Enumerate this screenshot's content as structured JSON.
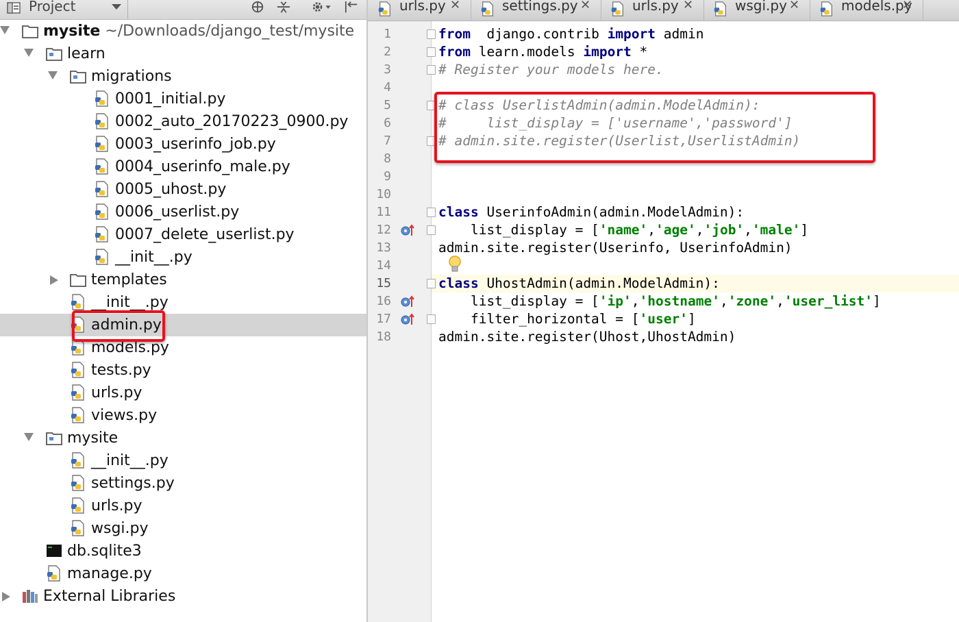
{
  "project_panel": {
    "title": "Project",
    "tree": [
      {
        "label": "mysite",
        "path": "~/Downloads/django_test/mysite",
        "kind": "folder",
        "bold": true,
        "expanded": true,
        "depth": 0
      },
      {
        "label": "learn",
        "kind": "module",
        "expanded": true,
        "depth": 1
      },
      {
        "label": "migrations",
        "kind": "module",
        "expanded": true,
        "depth": 2
      },
      {
        "label": "0001_initial.py",
        "kind": "py",
        "depth": 3
      },
      {
        "label": "0002_auto_20170223_0900.py",
        "kind": "py",
        "depth": 3
      },
      {
        "label": "0003_userinfo_job.py",
        "kind": "py",
        "depth": 3
      },
      {
        "label": "0004_userinfo_male.py",
        "kind": "py",
        "depth": 3
      },
      {
        "label": "0005_uhost.py",
        "kind": "py",
        "depth": 3
      },
      {
        "label": "0006_userlist.py",
        "kind": "py",
        "depth": 3
      },
      {
        "label": "0007_delete_userlist.py",
        "kind": "py",
        "depth": 3
      },
      {
        "label": "__init__.py",
        "kind": "py",
        "depth": 3
      },
      {
        "label": "templates",
        "kind": "folder",
        "expanded": false,
        "depth": 2
      },
      {
        "label": "__init__.py",
        "kind": "py",
        "depth": 2
      },
      {
        "label": "admin.py",
        "kind": "py",
        "depth": 2,
        "selected": true
      },
      {
        "label": "models.py",
        "kind": "py",
        "depth": 2
      },
      {
        "label": "tests.py",
        "kind": "py",
        "depth": 2
      },
      {
        "label": "urls.py",
        "kind": "py",
        "depth": 2
      },
      {
        "label": "views.py",
        "kind": "py",
        "depth": 2
      },
      {
        "label": "mysite",
        "kind": "module",
        "expanded": true,
        "depth": 1
      },
      {
        "label": "__init__.py",
        "kind": "py",
        "depth": 2
      },
      {
        "label": "settings.py",
        "kind": "py",
        "depth": 2
      },
      {
        "label": "urls.py",
        "kind": "py",
        "depth": 2
      },
      {
        "label": "wsgi.py",
        "kind": "py",
        "depth": 2
      },
      {
        "label": "db.sqlite3",
        "kind": "db",
        "depth": 1
      },
      {
        "label": "manage.py",
        "kind": "py",
        "depth": 1
      },
      {
        "label": "External Libraries",
        "kind": "lib",
        "expanded": false,
        "depth": 0
      }
    ]
  },
  "editor": {
    "tabs": [
      {
        "label": "urls.py",
        "close": "✕"
      },
      {
        "label": "settings.py",
        "close": "✕"
      },
      {
        "label": "urls.py",
        "close": "✕"
      },
      {
        "label": "wsgi.py",
        "close": "✕"
      },
      {
        "label": "models.py",
        "close": "✕"
      }
    ],
    "current_line": 15,
    "lines": [
      [
        [
          "kw",
          "from"
        ],
        [
          "",
          "  django.contrib "
        ],
        [
          "kw",
          "import"
        ],
        [
          "",
          " admin"
        ]
      ],
      [
        [
          "kw",
          "from"
        ],
        [
          "",
          " learn.models "
        ],
        [
          "kw",
          "import"
        ],
        [
          "",
          " *"
        ]
      ],
      [
        [
          "cmt",
          "# Register your models here."
        ]
      ],
      [],
      [
        [
          "cmt",
          "# class UserlistAdmin(admin.ModelAdmin):"
        ]
      ],
      [
        [
          "cmt",
          "#     list_display = ['username','password']"
        ]
      ],
      [
        [
          "cmt",
          "# admin.site.register(Userlist,UserlistAdmin)"
        ]
      ],
      [],
      [],
      [],
      [
        [
          "kw",
          "class"
        ],
        [
          "",
          " UserinfoAdmin(admin.ModelAdmin):"
        ]
      ],
      [
        [
          "",
          "    list_display = ["
        ],
        [
          "str",
          "'name'"
        ],
        [
          "",
          ","
        ],
        [
          "str",
          "'age'"
        ],
        [
          "",
          ","
        ],
        [
          "str",
          "'job'"
        ],
        [
          "",
          ","
        ],
        [
          "str",
          "'male'"
        ],
        [
          "",
          "]"
        ]
      ],
      [
        [
          "",
          "admin.site.register(Userinfo, UserinfoAdmin)"
        ]
      ],
      [],
      [
        [
          "kw",
          "class"
        ],
        [
          "",
          " UhostAdmin(admin.ModelAdmin):"
        ]
      ],
      [
        [
          "",
          "    list_display = ["
        ],
        [
          "str",
          "'ip'"
        ],
        [
          "",
          ","
        ],
        [
          "str",
          "'hostname'"
        ],
        [
          "",
          ","
        ],
        [
          "str",
          "'zone'"
        ],
        [
          "",
          ","
        ],
        [
          "str",
          "'user_list'"
        ],
        [
          "",
          "]"
        ]
      ],
      [
        [
          "",
          "    filter_horizontal = ["
        ],
        [
          "str",
          "'user'"
        ],
        [
          "",
          "]"
        ]
      ],
      [
        [
          "",
          "admin.site.register(Uhost,UhostAdmin)"
        ]
      ]
    ]
  },
  "colors": {
    "keyword": "#000080",
    "string": "#008000",
    "comment": "#808080",
    "highlight_box": "#e8121d",
    "selection": "#d4d4d4"
  }
}
